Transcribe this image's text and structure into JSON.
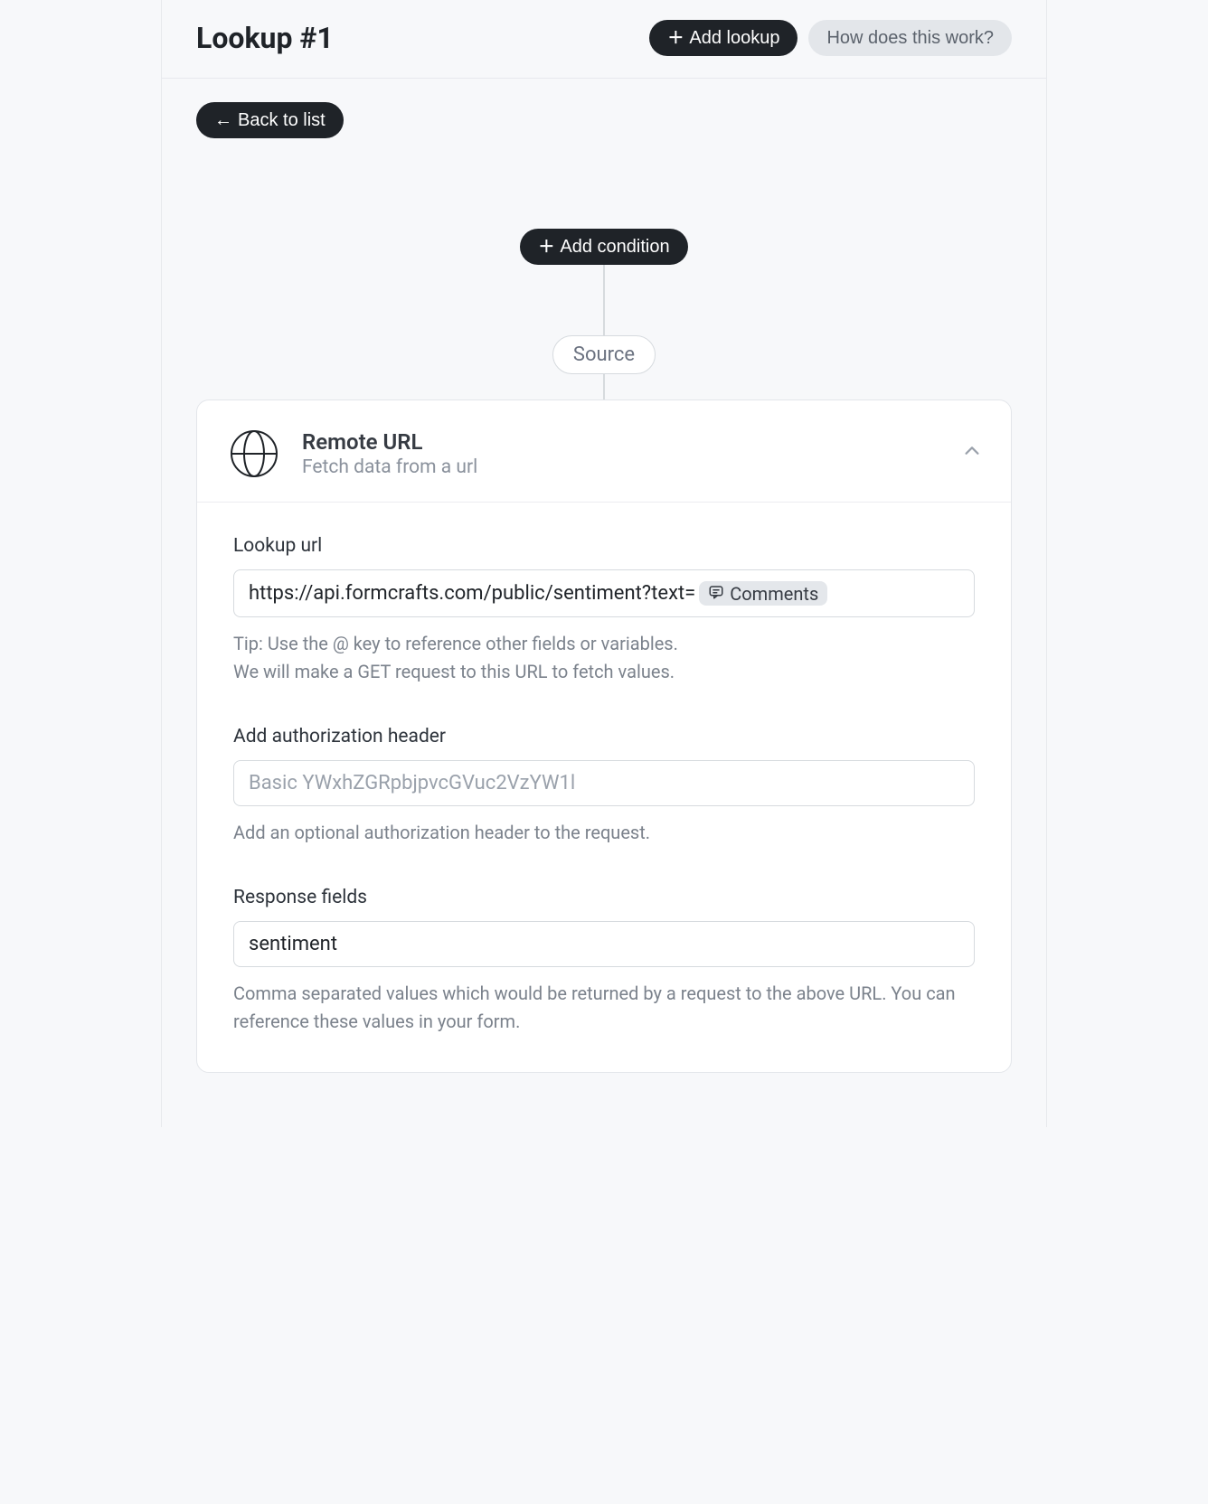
{
  "header": {
    "title": "Lookup #1",
    "add_lookup_label": "Add lookup",
    "help_label": "How does this work?"
  },
  "back_label": "Back to list",
  "flow": {
    "add_condition_label": "Add condition",
    "source_chip_label": "Source"
  },
  "card": {
    "title": "Remote URL",
    "subtitle": "Fetch data from a url"
  },
  "lookup_url": {
    "label": "Lookup url",
    "url_text": "https://api.formcrafts.com/public/sentiment?text=",
    "chip_label": "Comments",
    "tip_line1": "Tip: Use the @ key to reference other fields or variables.",
    "tip_line2": "We will make a GET request to this URL to fetch values."
  },
  "auth_header": {
    "label": "Add authorization header",
    "placeholder": "Basic YWxhZGRpbjpvcGVuc2VzYW1l",
    "value": "",
    "help": "Add an optional authorization header to the request."
  },
  "response_fields": {
    "label": "Response fields",
    "value": "sentiment",
    "help": "Comma separated values which would be returned by a request to the above URL. You can reference these values in your form."
  }
}
